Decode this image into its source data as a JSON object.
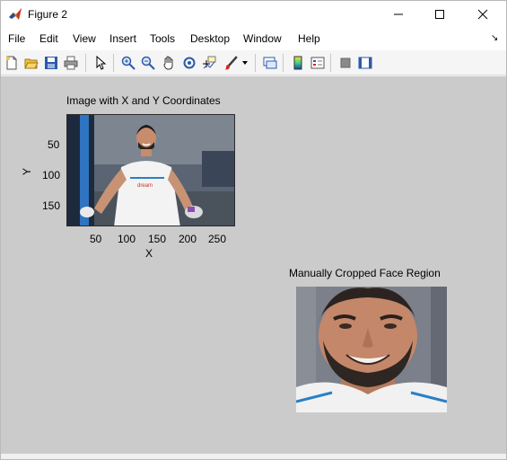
{
  "window": {
    "title": "Figure 2"
  },
  "menu": [
    "File",
    "Edit",
    "View",
    "Insert",
    "Tools",
    "Desktop",
    "Window",
    "Help"
  ],
  "toolbar": {
    "icons": [
      "new-figure-icon",
      "open-file-icon",
      "save-icon",
      "print-icon",
      "edit-plot-icon",
      "zoom-in-icon",
      "zoom-out-icon",
      "pan-icon",
      "rotate-3d-icon",
      "data-cursor-icon",
      "brush-icon",
      "link-plot-icon",
      "colorbar-icon",
      "legend-icon",
      "hide-plot-tools-icon",
      "show-plot-tools-icon"
    ]
  },
  "axes1": {
    "title": "Image with X and Y Coordinates",
    "xlabel": "X",
    "ylabel": "Y",
    "xticks": [
      "50",
      "100",
      "150",
      "200",
      "250"
    ],
    "yticks": [
      "50",
      "100",
      "150"
    ]
  },
  "axes2": {
    "title": "Manually Cropped Face Region"
  },
  "colors": {
    "figure_bg": "#cbcbcb",
    "toolbar_bg": "#f5f5f5",
    "jersey": "#f4f4f4",
    "jersey_trim": "#2a7fc4"
  }
}
